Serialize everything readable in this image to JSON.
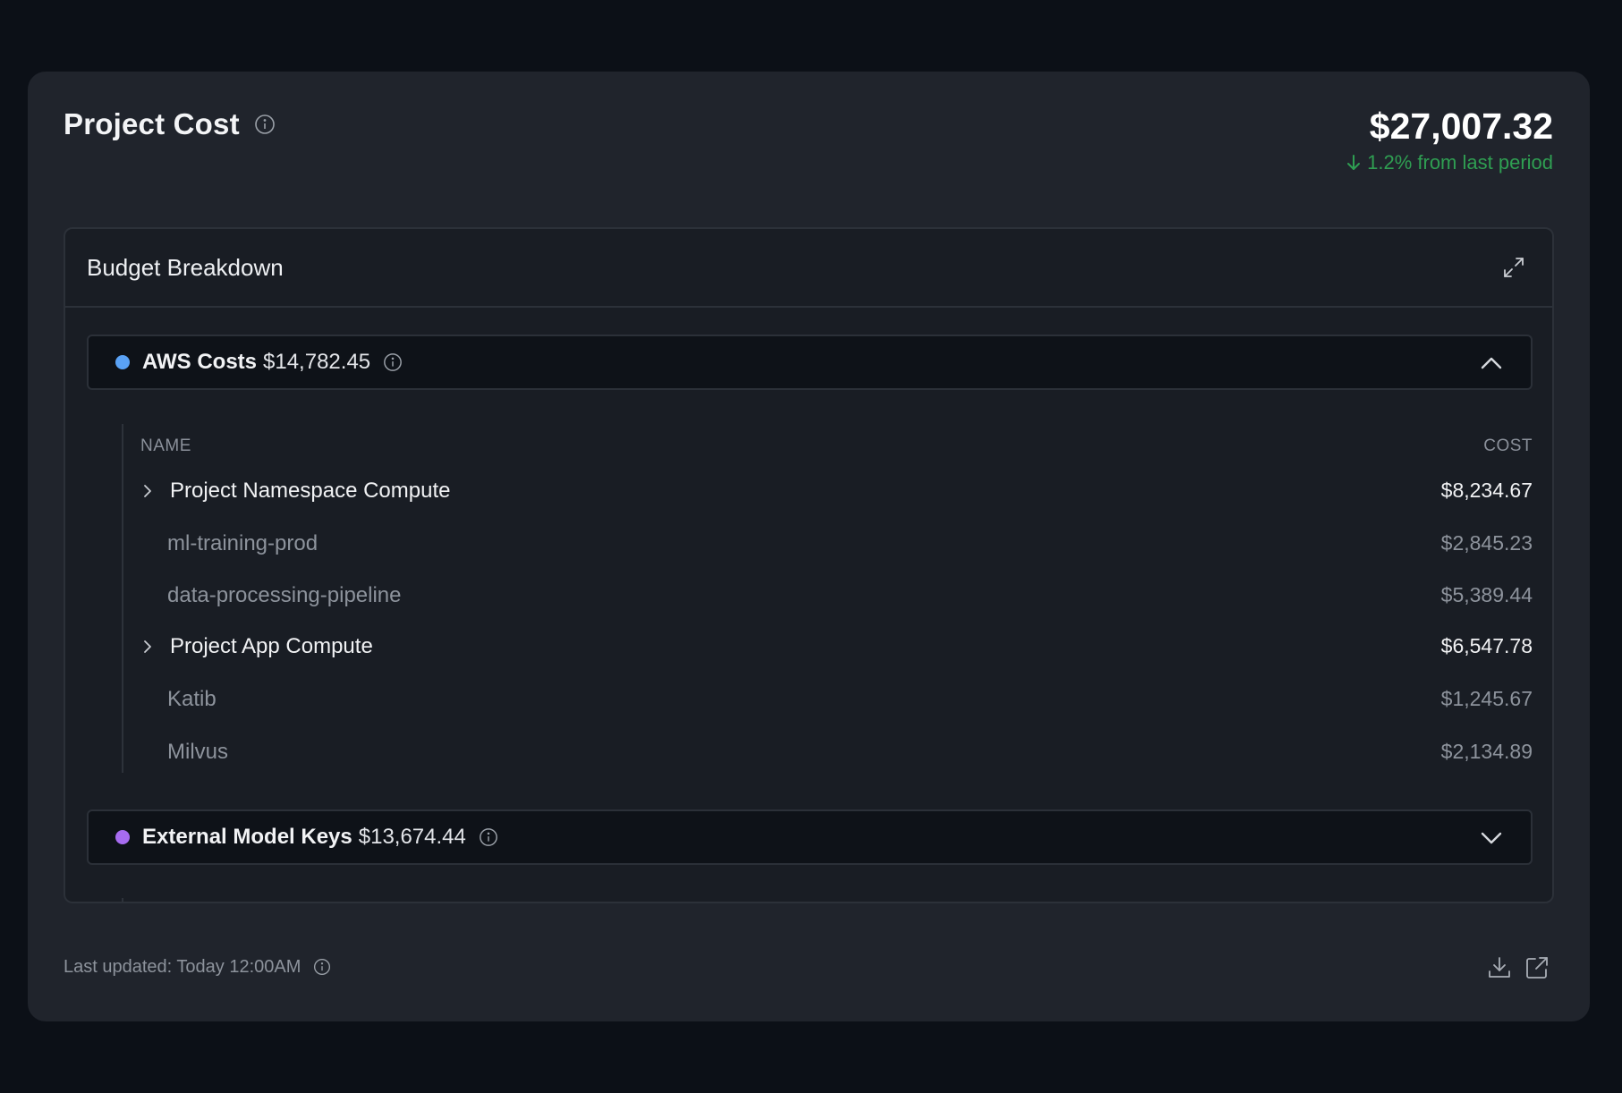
{
  "header": {
    "title": "Project Cost",
    "title_info_icon": "info-icon",
    "total_amount": "$27,007.32",
    "trend_icon": "arrow-down-icon",
    "trend_text": "1.2% from last period",
    "trend_color": "#2f9e52"
  },
  "panel": {
    "title": "Budget Breakdown",
    "expand_icon": "expand-icon"
  },
  "groups": [
    {
      "name": "AWS Costs",
      "amount": "$14,782.45",
      "color": "#5aa2f5",
      "expanded": true,
      "chevron_icon": "chevron-up-icon"
    },
    {
      "name": "External Model Keys",
      "amount": "$13,674.44",
      "color": "#a76cf0",
      "expanded": false,
      "chevron_icon": "chevron-down-icon"
    }
  ],
  "table": {
    "col_name": "NAME",
    "col_cost": "COST",
    "rows": [
      {
        "name": "Project Namespace Compute",
        "cost": "$8,234.67",
        "level": "parent"
      },
      {
        "name": "ml-training-prod",
        "cost": "$2,845.23",
        "level": "child"
      },
      {
        "name": "data-processing-pipeline",
        "cost": "$5,389.44",
        "level": "child"
      },
      {
        "name": "Project App Compute",
        "cost": "$6,547.78",
        "level": "parent"
      },
      {
        "name": "Katib",
        "cost": "$1,245.67",
        "level": "child"
      },
      {
        "name": "Milvus",
        "cost": "$2,134.89",
        "level": "child"
      }
    ]
  },
  "footer": {
    "last_updated": "Last updated: Today 12:00AM",
    "download_icon": "download-icon",
    "external_link_icon": "external-link-icon"
  }
}
